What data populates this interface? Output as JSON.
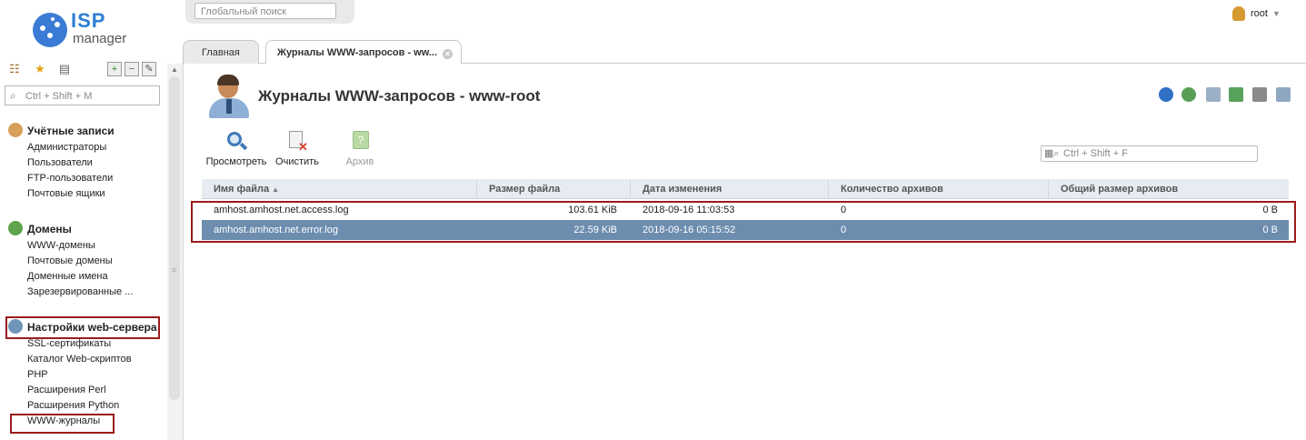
{
  "app": {
    "logo_top": "ISP",
    "logo_bottom": "manager"
  },
  "header": {
    "global_search_placeholder": "Глобальный поиск",
    "user": "root"
  },
  "tabs": [
    {
      "label": "Главная",
      "active": false
    },
    {
      "label": "Журналы WWW-запросов - ww...",
      "active": true
    }
  ],
  "sidebar": {
    "search_placeholder": "Ctrl + Shift + M",
    "groups": [
      {
        "title": "Учётные записи",
        "icon": "user-accounts-icon",
        "items": [
          "Администраторы",
          "Пользователи",
          "FTP-пользователи",
          "Почтовые ящики"
        ]
      },
      {
        "title": "Домены",
        "icon": "globe-icon",
        "items": [
          "WWW-домены",
          "Почтовые домены",
          "Доменные имена",
          "Зарезервированные ..."
        ]
      },
      {
        "title": "Настройки web-сервера",
        "icon": "web-server-settings-icon",
        "items": [
          "SSL-сертификаты",
          "Каталог Web-скриптов",
          "PHP",
          "Расширения Perl",
          "Расширения Python",
          "WWW-журналы"
        ]
      }
    ]
  },
  "page": {
    "title": "Журналы WWW-запросов - www-root",
    "filter_placeholder": "Ctrl + Shift + F",
    "toolbar": [
      {
        "label": "Просмотреть",
        "icon": "view-magnifier-icon",
        "disabled": false
      },
      {
        "label": "Очистить",
        "icon": "clear-log-icon",
        "disabled": false
      },
      {
        "label": "Архив",
        "icon": "archive-icon",
        "disabled": true
      }
    ],
    "right_icons": [
      "refresh-icon",
      "globe-settings-icon",
      "copy-icon",
      "excel-export-icon",
      "print-icon",
      "table-settings-icon"
    ]
  },
  "table": {
    "columns": [
      "Имя файла",
      "Размер файла",
      "Дата изменения",
      "Количество архивов",
      "Общий размер архивов"
    ],
    "rows": [
      {
        "name": "amhost.amhost.net.access.log",
        "size": "103.61 KiB",
        "modified": "2018-09-16 11:03:53",
        "archives": "0",
        "archives_size": "0 B",
        "selected": false
      },
      {
        "name": "amhost.amhost.net.error.log",
        "size": "22.59 KiB",
        "modified": "2018-09-16 05:15:52",
        "archives": "0",
        "archives_size": "0 B",
        "selected": true
      }
    ]
  }
}
